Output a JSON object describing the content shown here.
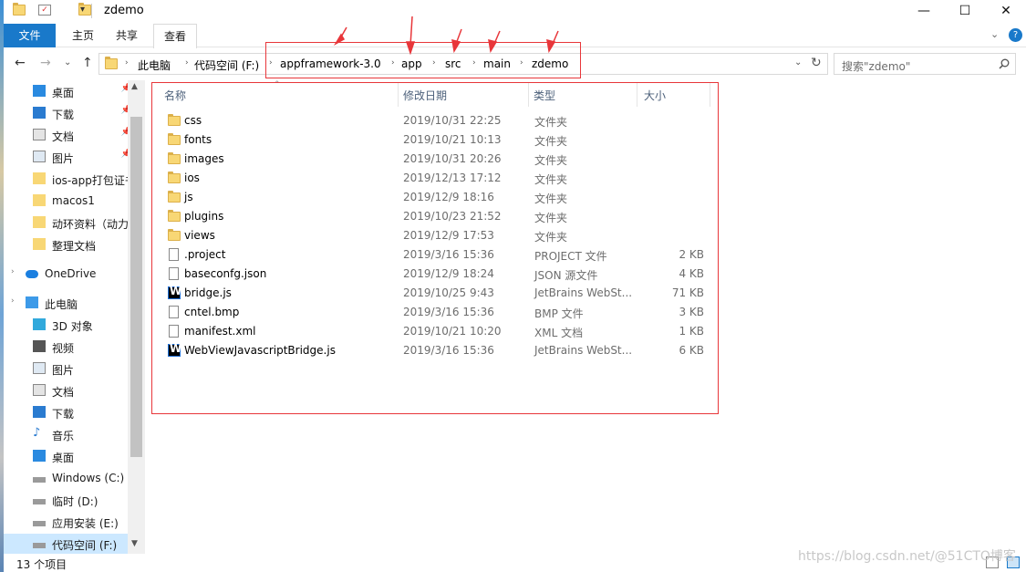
{
  "window": {
    "title": "zdemo",
    "controls": {
      "minimize": "—",
      "maximize": "☐",
      "close": "✕"
    }
  },
  "ribbon": {
    "tabs": [
      "文件",
      "主页",
      "共享",
      "查看"
    ]
  },
  "nav": {
    "back": "←",
    "forward": "→",
    "recent": "⌄",
    "up": "↑"
  },
  "address": {
    "segments": [
      "此电脑",
      "代码空间 (F:)",
      "appframework-3.0",
      "app",
      "src",
      "main",
      "zdemo"
    ]
  },
  "search": {
    "placeholder": "搜索\"zdemo\""
  },
  "sidebar": {
    "items": [
      {
        "label": "桌面",
        "icon": "desktop-icon",
        "pinned": true
      },
      {
        "label": "下载",
        "icon": "download-icon",
        "pinned": true
      },
      {
        "label": "文档",
        "icon": "document-icon",
        "pinned": true
      },
      {
        "label": "图片",
        "icon": "pictures-icon",
        "pinned": true
      },
      {
        "label": "ios-app打包证书",
        "icon": "folder-icon",
        "pinned": false
      },
      {
        "label": "macos1",
        "icon": "folder-icon",
        "pinned": false
      },
      {
        "label": "动环资料（动力环境）",
        "icon": "folder-icon",
        "pinned": false
      },
      {
        "label": "整理文档",
        "icon": "folder-icon",
        "pinned": false
      },
      {
        "label": "OneDrive",
        "icon": "onedrive-icon",
        "pinned": false
      },
      {
        "label": "此电脑",
        "icon": "this-pc-icon",
        "pinned": false
      },
      {
        "label": "3D 对象",
        "icon": "3d-objects-icon",
        "pinned": false
      },
      {
        "label": "视频",
        "icon": "video-icon",
        "pinned": false
      },
      {
        "label": "图片",
        "icon": "pictures-icon",
        "pinned": false
      },
      {
        "label": "文档",
        "icon": "document-icon",
        "pinned": false
      },
      {
        "label": "下载",
        "icon": "download-icon",
        "pinned": false
      },
      {
        "label": "音乐",
        "icon": "music-icon",
        "pinned": false
      },
      {
        "label": "桌面",
        "icon": "desktop-icon",
        "pinned": false
      },
      {
        "label": "Windows (C:)",
        "icon": "drive-icon",
        "pinned": false
      },
      {
        "label": "临时 (D:)",
        "icon": "drive-icon",
        "pinned": false
      },
      {
        "label": "应用安装 (E:)",
        "icon": "drive-icon",
        "pinned": false
      },
      {
        "label": "代码空间 (F:)",
        "icon": "drive-icon",
        "pinned": false
      }
    ]
  },
  "columns": {
    "name": "名称",
    "date": "修改日期",
    "type": "类型",
    "size": "大小"
  },
  "files": [
    {
      "name": "css",
      "date": "2019/10/31 22:25",
      "type": "文件夹",
      "size": "",
      "icon": "folder"
    },
    {
      "name": "fonts",
      "date": "2019/10/21 10:13",
      "type": "文件夹",
      "size": "",
      "icon": "folder"
    },
    {
      "name": "images",
      "date": "2019/10/31 20:26",
      "type": "文件夹",
      "size": "",
      "icon": "folder"
    },
    {
      "name": "ios",
      "date": "2019/12/13 17:12",
      "type": "文件夹",
      "size": "",
      "icon": "folder"
    },
    {
      "name": "js",
      "date": "2019/12/9 18:16",
      "type": "文件夹",
      "size": "",
      "icon": "folder"
    },
    {
      "name": "plugins",
      "date": "2019/10/23 21:52",
      "type": "文件夹",
      "size": "",
      "icon": "folder"
    },
    {
      "name": "views",
      "date": "2019/12/9 17:53",
      "type": "文件夹",
      "size": "",
      "icon": "folder"
    },
    {
      "name": ".project",
      "date": "2019/3/16 15:36",
      "type": "PROJECT 文件",
      "size": "2 KB",
      "icon": "doc"
    },
    {
      "name": "baseconfg.json",
      "date": "2019/12/9 18:24",
      "type": "JSON 源文件",
      "size": "4 KB",
      "icon": "doc"
    },
    {
      "name": "bridge.js",
      "date": "2019/10/25 9:43",
      "type": "JetBrains WebSt...",
      "size": "71 KB",
      "icon": "ws"
    },
    {
      "name": "cntel.bmp",
      "date": "2019/3/16 15:36",
      "type": "BMP 文件",
      "size": "3 KB",
      "icon": "doc"
    },
    {
      "name": "manifest.xml",
      "date": "2019/10/21 10:20",
      "type": "XML 文档",
      "size": "1 KB",
      "icon": "doc"
    },
    {
      "name": "WebViewJavascriptBridge.js",
      "date": "2019/3/16 15:36",
      "type": "JetBrains WebSt...",
      "size": "6 KB",
      "icon": "ws"
    }
  ],
  "status": {
    "count": "13 个项目"
  },
  "watermark": "https://blog.csdn.net/@51CTO博客",
  "colors": {
    "accent": "#1979ca",
    "annotation": "#e8363a",
    "folder": "#f8d775"
  }
}
